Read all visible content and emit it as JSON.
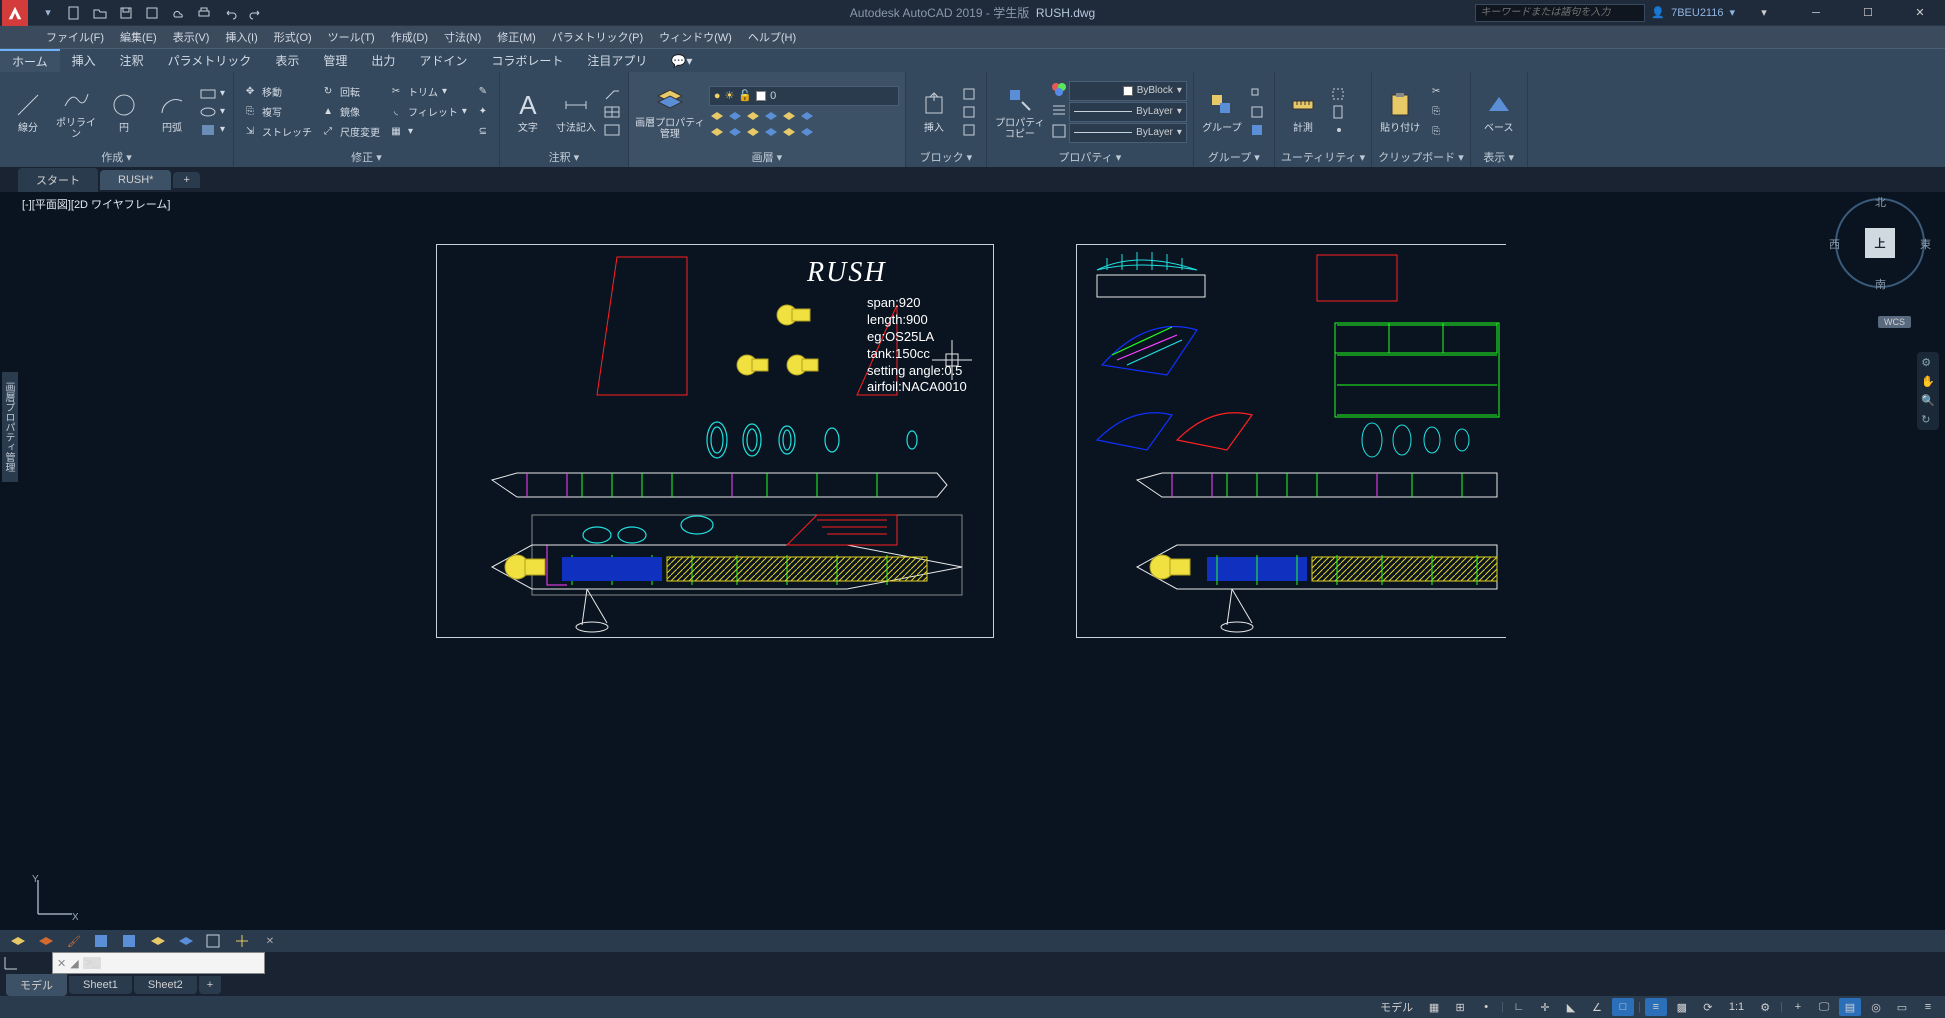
{
  "title": {
    "app": "Autodesk AutoCAD 2019 - 学生版",
    "file": "RUSH.dwg",
    "search_placeholder": "キーワードまたは語句を入力",
    "user": "7BEU2116"
  },
  "menu": [
    "ファイル(F)",
    "編集(E)",
    "表示(V)",
    "挿入(I)",
    "形式(O)",
    "ツール(T)",
    "作成(D)",
    "寸法(N)",
    "修正(M)",
    "パラメトリック(P)",
    "ウィンドウ(W)",
    "ヘルプ(H)"
  ],
  "rtabs": [
    "ホーム",
    "挿入",
    "注釈",
    "パラメトリック",
    "表示",
    "管理",
    "出力",
    "アドイン",
    "コラボレート",
    "注目アプリ"
  ],
  "panels": {
    "create": {
      "title": "作成 ▾",
      "line": "線分",
      "polyline": "ポリライン",
      "circle": "円",
      "arc": "円弧"
    },
    "modify": {
      "title": "修正 ▾",
      "move": "移動",
      "copy": "複写",
      "stretch": "ストレッチ",
      "rotate": "回転",
      "mirror": "鏡像",
      "scale": "尺度変更",
      "trim": "トリム",
      "fillet": "フィレット"
    },
    "annot": {
      "title": "注釈 ▾",
      "text": "文字",
      "dim": "寸法記入"
    },
    "layer": {
      "title": "画層 ▾",
      "mgr": "画層プロパティ\n管理",
      "current": "0"
    },
    "block": {
      "title": "ブロック ▾",
      "insert": "挿入"
    },
    "prop": {
      "title": "プロパティ ▾",
      "pcopy": "プロパティ\nコピー",
      "color": "ByBlock",
      "ltype": "ByLayer",
      "lweight": "ByLayer"
    },
    "group": {
      "title": "グループ ▾",
      "group": "グループ"
    },
    "util": {
      "title": "ユーティリティ ▾",
      "measure": "計測"
    },
    "clip": {
      "title": "クリップボード ▾",
      "paste": "貼り付け"
    },
    "view": {
      "title": "表示 ▾",
      "base": "ベース"
    }
  },
  "doctabs": {
    "start": "スタート",
    "file": "RUSH*"
  },
  "viewport": {
    "label": "[-][平面図][2D ワイヤフレーム]",
    "palette": "画層プロパティ管理"
  },
  "viewcube": {
    "n": "北",
    "s": "南",
    "e": "東",
    "w": "西",
    "top": "上",
    "wcs": "WCS"
  },
  "drawing": {
    "title": "RUSH",
    "specs": {
      "span": "span:920",
      "length": "length:900",
      "eg": "eg:OS25LA",
      "tank": "tank:150cc",
      "angle": "setting angle:0.5",
      "airfoil": "airfoil:NACA0010"
    }
  },
  "sheets": {
    "model": "モデル",
    "s1": "Sheet1",
    "s2": "Sheet2"
  },
  "status": {
    "model": "モデル",
    "scale": "1:1"
  },
  "cmd": {
    "prompt": ">_"
  }
}
